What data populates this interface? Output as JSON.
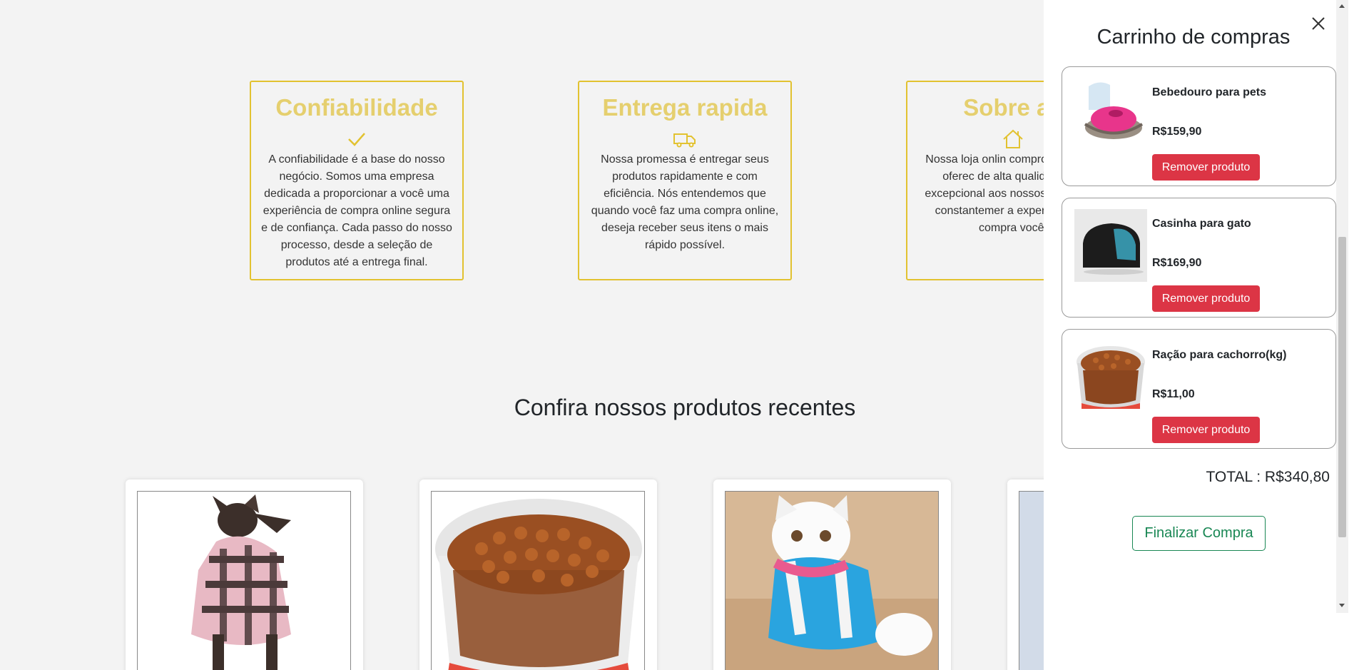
{
  "features": [
    {
      "title": "Confiabilidade",
      "icon": "check-icon",
      "text": "A confiabilidade é a base do nosso negócio. Somos uma empresa dedicada a proporcionar a você uma experiência de compra online segura e de confiança. Cada passo do nosso processo, desde a seleção de produtos até a entrega final."
    },
    {
      "title": "Entrega rapida",
      "icon": "truck-icon",
      "text": "Nossa promessa é entregar seus produtos rapidamente e com eficiência. Nós entendemos que quando você faz uma compra online, deseja receber seus itens o mais rápido possível."
    },
    {
      "title": "Sobre a l",
      "icon": "house-icon",
      "text": "Nossa loja onlin comprometida em oferec de alta qualidade e u excepcional aos nossos buscamos constantemer a experiência de compra você."
    }
  ],
  "recent": {
    "title": "Confira nossos produtos recentes"
  },
  "cart": {
    "title": "Carrinho de compras",
    "items": [
      {
        "name": "Bebedouro para pets",
        "price": "R$159,90",
        "remove_label": "Remover produto",
        "thumb": "pet-fountain-image"
      },
      {
        "name": "Casinha para gato",
        "price": "R$169,90",
        "remove_label": "Remover produto",
        "thumb": "cat-house-image"
      },
      {
        "name": "Ração para cachorro(kg)",
        "price": "R$11,00",
        "remove_label": "Remover produto",
        "thumb": "dog-food-image"
      }
    ],
    "total": "TOTAL : R$340,80",
    "checkout_label": "Finalizar Compra"
  },
  "colors": {
    "accent": "#e5cf6e",
    "border": "#e2c230",
    "danger": "#dc3545",
    "success": "#198754"
  }
}
